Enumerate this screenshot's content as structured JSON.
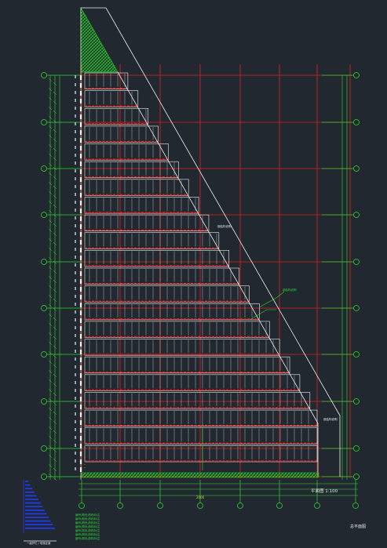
{
  "colors": {
    "background": "#212830",
    "grid_red": "#e0211d",
    "axis_green": "#2fd631",
    "outline_white": "#f2f2f2",
    "hatch_green": "#27c42a",
    "legend_blue": "#1f3cff",
    "dim_yellow": "#d9d23a",
    "label_white": "#e8e8e8"
  },
  "drawing": {
    "scale_label": "平面图 1:100",
    "sheet_title": "总平面图",
    "dimension_label": "2000"
  },
  "legend": {
    "notes": [
      "编号/颜色说明/标注",
      "编号/颜色说明/标注",
      "编号/颜色说明/标注",
      "编号/颜色说明/标注",
      "编号/颜色说明/标注",
      "编号/颜色说明/标注",
      "编号/颜色说明/标注"
    ],
    "caption": "一级护栏 / 电梯走道"
  },
  "annotations": {
    "callout_a": "钢结构说明",
    "callout_b": "钢结构说明",
    "callout_c": "钢结构说明"
  }
}
